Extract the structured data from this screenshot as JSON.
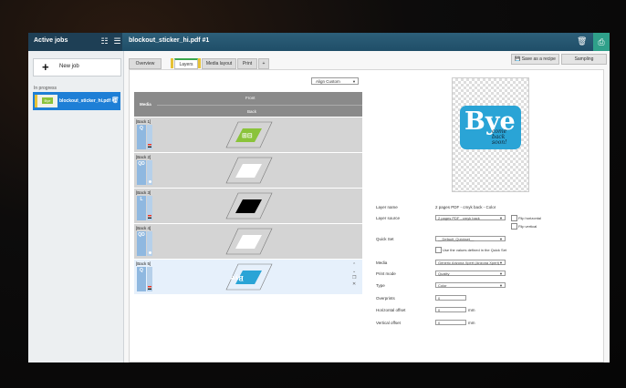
{
  "header": {
    "sidebar_title": "Active jobs",
    "job_title": "blockout_sticker_hi.pdf #1"
  },
  "sidebar": {
    "new_job_label": "New job",
    "section_label": "In progress",
    "jobs": [
      {
        "label": "blockout_sticker_hi.pdf #1"
      }
    ]
  },
  "tabs": [
    {
      "label": "Overview"
    },
    {
      "label": "Layers"
    },
    {
      "label": "Media layout"
    },
    {
      "label": "Print"
    },
    {
      "label": "+"
    }
  ],
  "actions": {
    "save_recipe": "Save as a recipe",
    "sampling": "Sampling"
  },
  "layers": {
    "align_select": "Align Custom",
    "headers": {
      "media": "Media",
      "front": "Front",
      "back": "Back"
    },
    "rows": [
      {
        "label": "[Back 1]",
        "card": "Q"
      },
      {
        "label": "[Back 2]",
        "card": "QD"
      },
      {
        "label": "[Back 3]",
        "card": "L"
      },
      {
        "label": "[Back 4]",
        "card": "QD"
      },
      {
        "label": "[Back 5]",
        "card": "Q"
      }
    ]
  },
  "preview": {
    "headline": "Bye",
    "subline": "come back soon!"
  },
  "properties": {
    "layer_name_label": "Layer name",
    "layer_name_value": "2 pages PDF - cmyk back - Color",
    "layer_source_label": "Layer source",
    "layer_source_value": "2 pages PDF - cmyk back",
    "flip_horizontal": "Flip horizontal",
    "flip_vertical": "Flip vertical",
    "quick_set_label": "Quick Set",
    "quick_set_value": "__Default_Quickset__",
    "use_values_label": "Use the values defined in the Quick Set",
    "media_label": "Media",
    "media_value": "Generic Arizona Xpert (Arizona Xpert)",
    "print_mode_label": "Print mode",
    "print_mode_value": "Quality",
    "type_label": "Type",
    "type_value": "Color",
    "overprints_label": "Overprints",
    "overprints_value": "0",
    "h_offset_label": "Horizontal offset",
    "h_offset_value": "0",
    "v_offset_label": "Vertical offset",
    "v_offset_value": "0",
    "unit": "mm"
  }
}
